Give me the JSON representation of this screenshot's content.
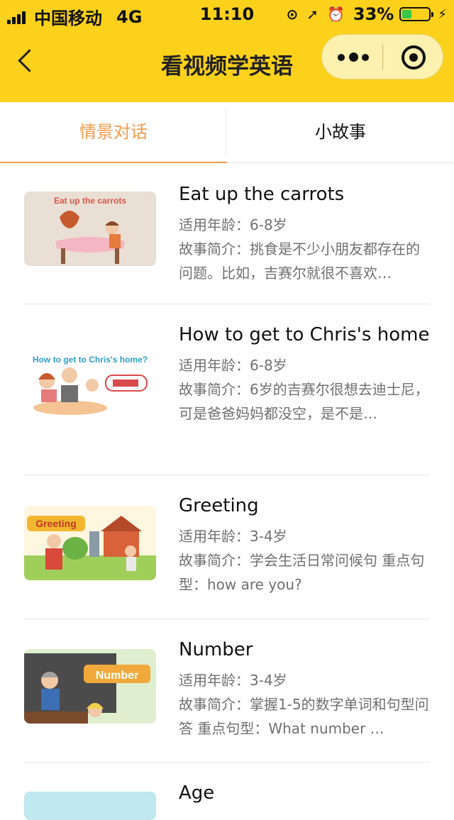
{
  "status_bar": {
    "carrier": "中国移动",
    "network": "4G",
    "time": "11:10",
    "battery": "33%"
  },
  "nav": {
    "title": "看视频学英语"
  },
  "tabs": [
    {
      "label": "情景对话",
      "active": true
    },
    {
      "label": "小故事",
      "active": false
    }
  ],
  "videos": [
    {
      "title": "Eat up the carrots",
      "thumb_text": "Eat up the carrots",
      "age": "适用年龄：6-8岁",
      "desc": "故事简介：挑食是不少小朋友都存在的问题。比如，吉赛尔就很不喜欢…"
    },
    {
      "title": "How to get to Chris's home",
      "thumb_text": "How to get to Chris's home?",
      "age": "适用年龄：6-8岁",
      "desc": "故事简介：6岁的吉赛尔很想去迪士尼，可是爸爸妈妈都没空，是不是…"
    },
    {
      "title": "Greeting",
      "thumb_text": "Greeting",
      "age": "适用年龄：3-4岁",
      "desc": "故事简介：学会生活日常问候句 重点句型：how are you?"
    },
    {
      "title": "Number",
      "thumb_text": "Number",
      "age": "适用年龄：3-4岁",
      "desc": "故事简介：掌握1-5的数字单词和句型问答 重点句型：What number …"
    },
    {
      "title": "Age",
      "thumb_text": "",
      "age": "",
      "desc": ""
    }
  ]
}
